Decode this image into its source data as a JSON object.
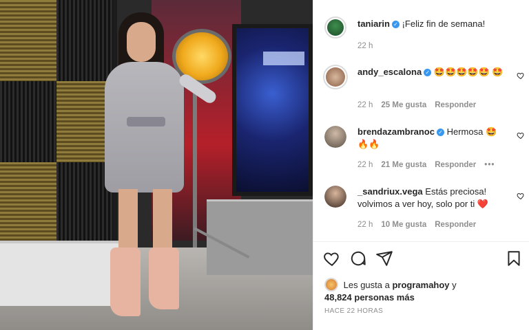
{
  "caption": {
    "username": "taniarin",
    "text": "¡Feliz fin de semana!",
    "time": "22 h"
  },
  "comments": [
    {
      "username": "andy_escalona",
      "text": "🤩🤩🤩🤩🤩 🤩",
      "time": "22 h",
      "likes": "25 Me gusta",
      "reply": "Responder"
    },
    {
      "username": "brendazambranoc",
      "text": "Hermosa 🤩 🔥🔥",
      "time": "22 h",
      "likes": "21 Me gusta",
      "reply": "Responder",
      "more": "•••"
    },
    {
      "username": "_sandriux.vega",
      "text": "Estás preciosa! volvimos a ver hoy, solo por ti ❤️",
      "time": "22 h",
      "likes": "10 Me gusta",
      "reply": "Responder"
    }
  ],
  "likes_line": {
    "prefix": "Les gusta a",
    "user": "programahoy",
    "joiner": "y",
    "count": "48,824 personas más"
  },
  "posted": "HACE 22 HORAS",
  "icons": {
    "like": "heart-icon",
    "comment": "comment-icon",
    "share": "share-icon",
    "save": "bookmark-icon",
    "comment_like": "heart-outline-icon"
  },
  "colors": {
    "verified": "#3897f0",
    "text": "#262626",
    "muted": "#8e8e8e",
    "heart_red": "#ed4956"
  }
}
